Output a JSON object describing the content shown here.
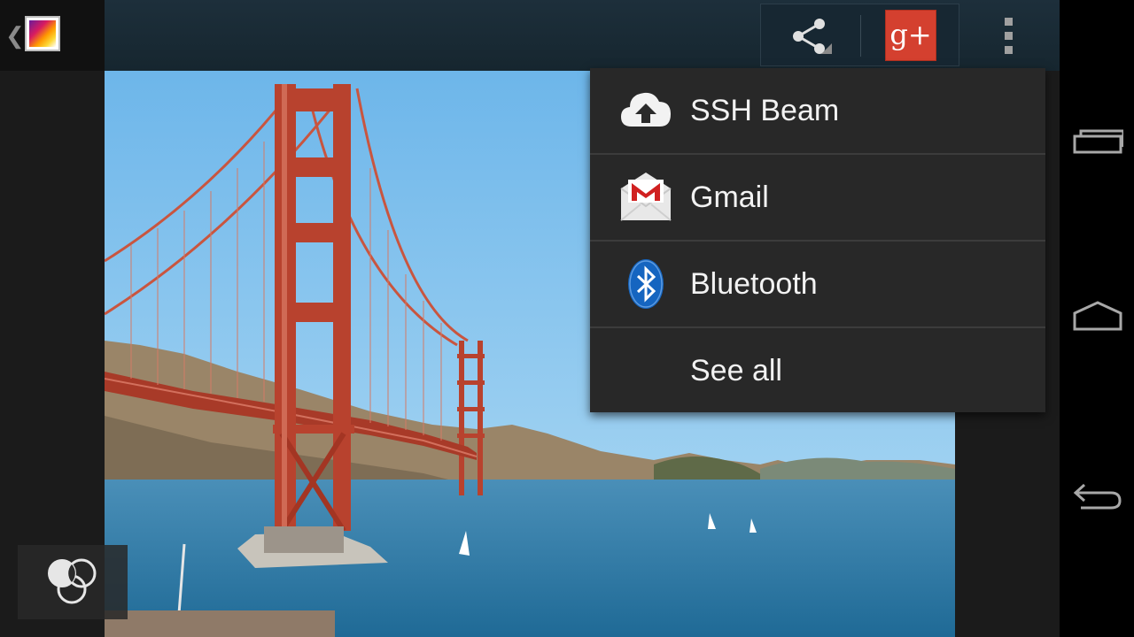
{
  "actionbar": {
    "up_icon": "chevron-left-icon",
    "app_icon": "gallery-app-icon",
    "share_icon": "share-icon",
    "gplus_label": "g+",
    "overflow_icon": "overflow-menu-icon"
  },
  "share_menu": {
    "items": [
      {
        "label": "SSH Beam",
        "icon": "cloud-upload-icon"
      },
      {
        "label": "Gmail",
        "icon": "gmail-icon"
      },
      {
        "label": "Bluetooth",
        "icon": "bluetooth-icon"
      },
      {
        "label": "See all",
        "icon": ""
      }
    ]
  },
  "photo": {
    "subject": "golden-gate-bridge-photo"
  },
  "filter": {
    "icon": "filters-icon"
  },
  "navbar": {
    "recents_icon": "recent-apps-icon",
    "home_icon": "home-icon",
    "back_icon": "back-icon"
  },
  "colors": {
    "accent_red": "#d4402f",
    "bridge": "#b8422e",
    "sky": "#8ccbf0",
    "water": "#2c7ba8",
    "menu_bg": "#282828"
  }
}
